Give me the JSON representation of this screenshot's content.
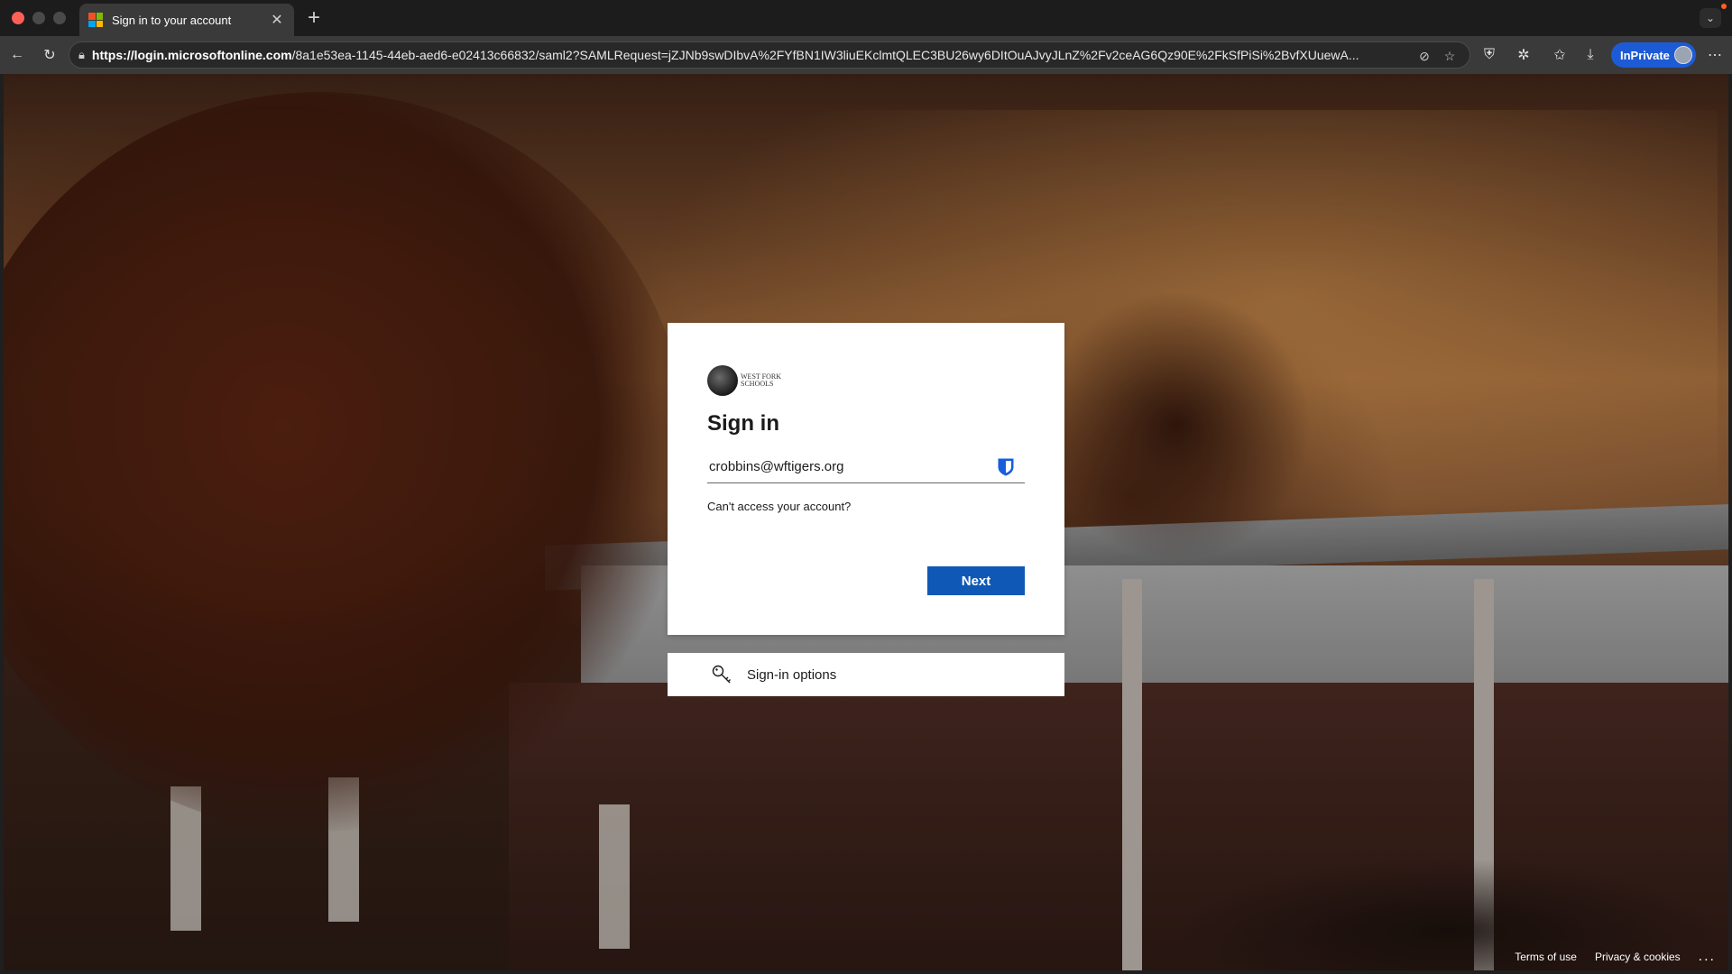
{
  "browser": {
    "tab": {
      "title": "Sign in to your account"
    },
    "url_host": "https://login.microsoftonline.com",
    "url_rest": "/8a1e53ea-1145-44eb-aed6-e02413c66832/saml2?SAMLRequest=jZJNb9swDIbvA%2FYfBN1IW3liuEKclmtQLEC3BU26wy6DItOuAJvyJLnZ%2Fv2ceAG6Qz90E%2FkSfPiSi%2BvfXUuewA...",
    "inprivate_label": "InPrivate"
  },
  "signin": {
    "logo_text": "WEST FORK SCHOOLS",
    "title": "Sign in",
    "email_value": "crobbins@wftigers.org",
    "cant_access_link": "Can't access your account?",
    "next_label": "Next"
  },
  "options": {
    "label": "Sign-in options"
  },
  "footer": {
    "terms": "Terms of use",
    "privacy": "Privacy & cookies",
    "more": "..."
  }
}
